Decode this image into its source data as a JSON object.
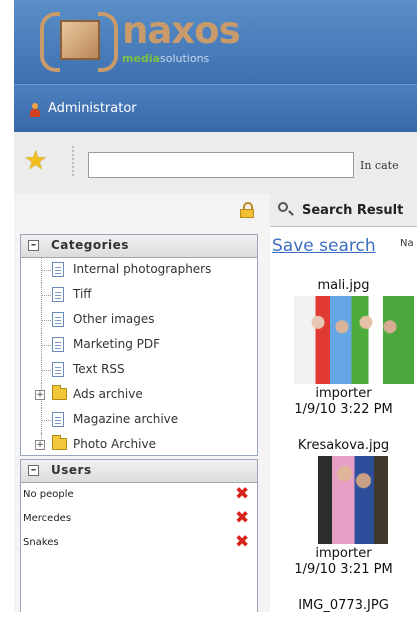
{
  "brand": {
    "name": "naxos",
    "sub_a": "media",
    "sub_b": "solutions"
  },
  "user": {
    "name": "Administrator"
  },
  "search": {
    "value": "",
    "in_categories": "In cate"
  },
  "categories": {
    "title": "Categories",
    "items": [
      {
        "label": "Internal photographers",
        "icon": "page-icon"
      },
      {
        "label": "Tiff",
        "icon": "page-icon"
      },
      {
        "label": "Other images",
        "icon": "page-icon"
      },
      {
        "label": "Marketing PDF",
        "icon": "page-icon"
      },
      {
        "label": "Text RSS",
        "icon": "page-icon"
      },
      {
        "label": "Ads archive",
        "icon": "folder-icon",
        "expandable": true
      },
      {
        "label": "Magazine archive",
        "icon": "page-icon"
      },
      {
        "label": "Photo Archive",
        "icon": "folder-icon",
        "expandable": true
      }
    ]
  },
  "users": {
    "title": "Users",
    "items": [
      {
        "label": "No people"
      },
      {
        "label": "Mercedes"
      },
      {
        "label": "Snakes"
      }
    ]
  },
  "results": {
    "title": "Search Result",
    "save_search": "Save search",
    "na": "Na",
    "items": [
      {
        "filename": "mali.jpg",
        "user": "importer",
        "date": "1/9/10 3:22 PM"
      },
      {
        "filename": "Kresakova.jpg",
        "user": "importer",
        "date": "1/9/10 3:21 PM"
      },
      {
        "filename": "IMG_0773.JPG"
      }
    ]
  }
}
